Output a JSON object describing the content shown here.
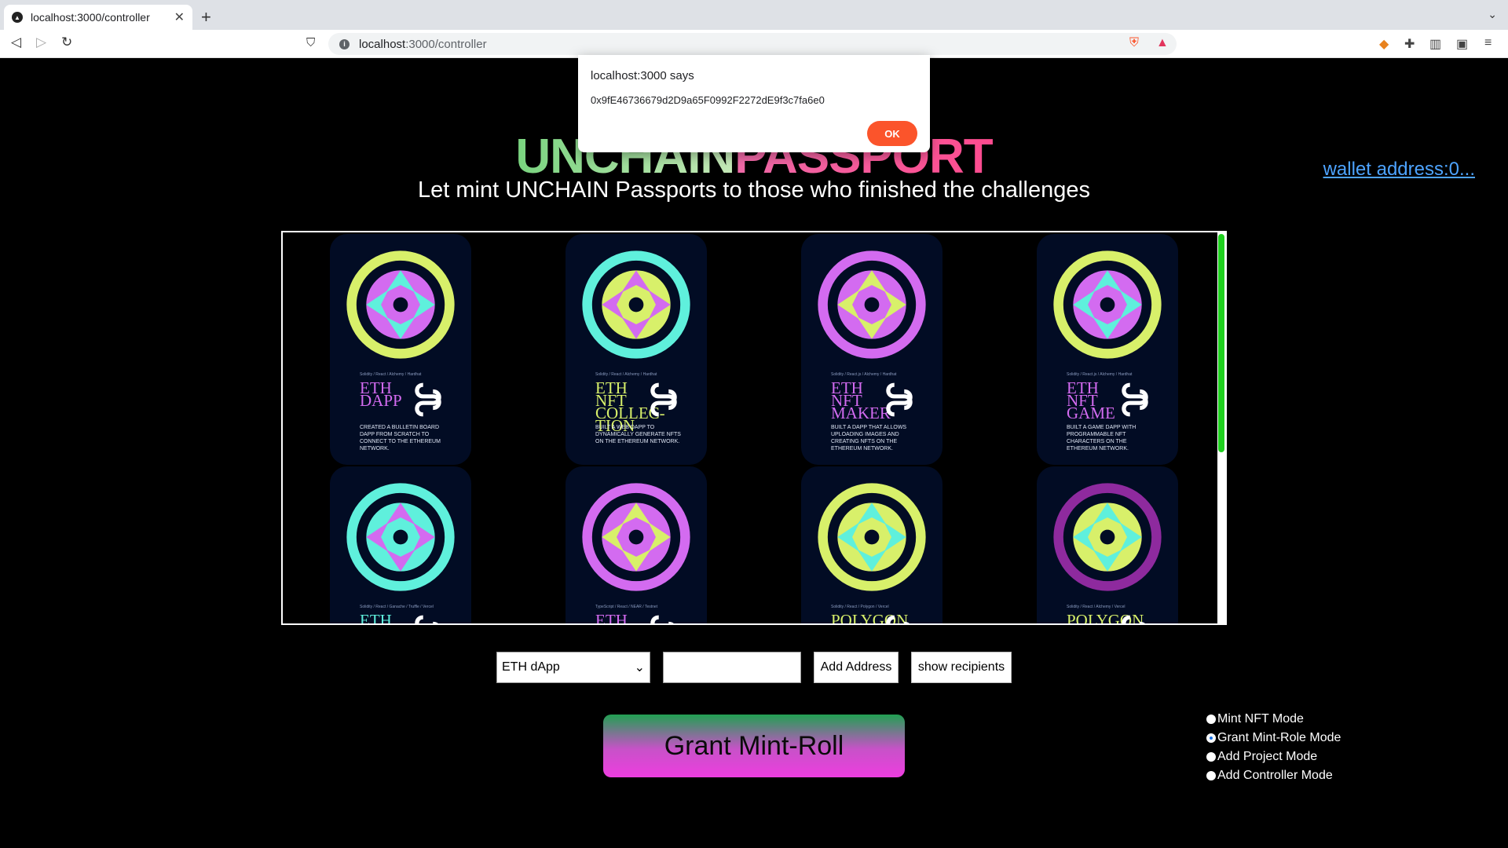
{
  "browser": {
    "tab_title": "localhost:3000/controller",
    "url_host": "localhost",
    "url_path": ":3000/controller"
  },
  "header": {
    "title_part1": "UNCHAIN",
    "title_part2": "PASSPORT",
    "subtitle": "Let mint UNCHAIN Passports to those who finished the challenges",
    "wallet_link": "wallet address:0..."
  },
  "cards": [
    {
      "tags": "Solidity / React / Alchemy / Hardhat",
      "name": "ETH DAPP",
      "desc": "Created a bulletin board dapp from scratch to connect to the Ethereum network.",
      "color": "#d36bf0",
      "ring": "#d8f06a",
      "accent": "#5ff0dc"
    },
    {
      "tags": "Solidity / React / Alchemy / Hardhat",
      "name": "ETH NFT COLLEC-TION",
      "desc": "Built a web dapp to dynamically generate NFTs on the Ethereum network.",
      "color": "#d8f06a",
      "ring": "#5ff0dc",
      "accent": "#d36bf0"
    },
    {
      "tags": "Solidity / React.js / Alchemy / Hardhat",
      "name": "ETH NFT MAKER",
      "desc": "Built a dapp that allows uploading images and creating NFTs on the Ethereum network.",
      "color": "#d36bf0",
      "ring": "#d36bf0",
      "accent": "#d8f06a"
    },
    {
      "tags": "Solidity / React.js / Alchemy / Hardhat",
      "name": "ETH NFT GAME",
      "desc": "Built a game dapp with programmable NFT characters on the Ethereum network.",
      "color": "#d36bf0",
      "ring": "#d8f06a",
      "accent": "#5ff0dc"
    },
    {
      "tags": "Solidity / React / Ganache / Truffle / Vercel",
      "name": "ETH",
      "desc": "",
      "color": "#5ff0dc",
      "ring": "#5ff0dc",
      "accent": "#d36bf0"
    },
    {
      "tags": "TypeScript / React / NEAR / Testnet",
      "name": "ETH",
      "desc": "",
      "color": "#d36bf0",
      "ring": "#d36bf0",
      "accent": "#d8f06a"
    },
    {
      "tags": "Solidity / React / Polygon / Vercel",
      "name": "POLYGON",
      "desc": "",
      "color": "#d8f06a",
      "ring": "#d8f06a",
      "accent": "#5ff0dc"
    },
    {
      "tags": "Solidity / React / Alchemy / Vercel",
      "name": "POLYGON",
      "desc": "",
      "color": "#d8f06a",
      "ring": "#8e2a9e",
      "accent": "#5ff0dc"
    }
  ],
  "controls": {
    "project_select": "ETH dApp",
    "address_value": "",
    "add_address_label": "Add Address",
    "show_recipients_label": "show recipients",
    "grant_label": "Grant Mint-Roll"
  },
  "modes": [
    {
      "label": "Mint NFT Mode",
      "selected": false
    },
    {
      "label": "Grant Mint-Role Mode",
      "selected": true
    },
    {
      "label": "Add Project Mode",
      "selected": false
    },
    {
      "label": "Add Controller Mode",
      "selected": false
    }
  ],
  "dialog": {
    "title": "localhost:3000 says",
    "message": "0x9fE46736679d2D9a65F0992F2272dE9f3c7fa6e0",
    "ok_label": "OK"
  }
}
